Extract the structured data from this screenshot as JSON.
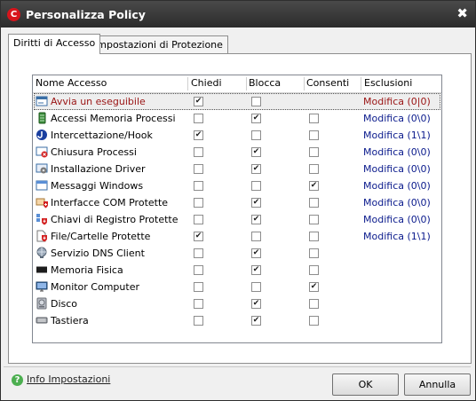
{
  "window": {
    "title": "Personalizza Policy",
    "close_glyph": "✖"
  },
  "tabs": [
    {
      "label": "Diritti di Accesso",
      "active": true
    },
    {
      "label": "Impostazioni di Protezione",
      "active": false
    }
  ],
  "table": {
    "columns": [
      "Nome Accesso",
      "Chiedi",
      "Blocca",
      "Consenti",
      "Esclusioni"
    ],
    "rows": [
      {
        "name": "Avvia un eseguibile",
        "icon": "window-run-icon",
        "chiedi": true,
        "blocca": false,
        "consenti": null,
        "esclusioni": "Modifica (0|0)",
        "selected": true
      },
      {
        "name": "Accessi Memoria Processi",
        "icon": "memory-process-icon",
        "chiedi": false,
        "blocca": true,
        "consenti": false,
        "esclusioni": "Modifica (0\\0)"
      },
      {
        "name": "Intercettazione/Hook",
        "icon": "hook-icon",
        "chiedi": true,
        "blocca": false,
        "consenti": false,
        "esclusioni": "Modifica (1\\1)"
      },
      {
        "name": "Chiusura Processi",
        "icon": "close-process-icon",
        "chiedi": false,
        "blocca": true,
        "consenti": false,
        "esclusioni": "Modifica (0\\0)"
      },
      {
        "name": "Installazione Driver",
        "icon": "driver-install-icon",
        "chiedi": false,
        "blocca": true,
        "consenti": false,
        "esclusioni": "Modifica (0\\0)"
      },
      {
        "name": "Messaggi Windows",
        "icon": "windows-messages-icon",
        "chiedi": false,
        "blocca": false,
        "consenti": true,
        "esclusioni": "Modifica (0\\0)"
      },
      {
        "name": "Interfacce COM Protette",
        "icon": "com-shield-icon",
        "chiedi": false,
        "blocca": true,
        "consenti": false,
        "esclusioni": "Modifica (0\\0)"
      },
      {
        "name": "Chiavi di Registro Protette",
        "icon": "registry-shield-icon",
        "chiedi": false,
        "blocca": true,
        "consenti": false,
        "esclusioni": "Modifica (0\\0)"
      },
      {
        "name": "File/Cartelle Protette",
        "icon": "file-shield-icon",
        "chiedi": true,
        "blocca": false,
        "consenti": false,
        "esclusioni": "Modifica (1\\1)"
      },
      {
        "name": "Servizio DNS Client",
        "icon": "dns-globe-icon",
        "chiedi": false,
        "blocca": true,
        "consenti": false,
        "esclusioni": ""
      },
      {
        "name": "Memoria Fisica",
        "icon": "ram-chip-icon",
        "chiedi": false,
        "blocca": true,
        "consenti": false,
        "esclusioni": ""
      },
      {
        "name": "Monitor Computer",
        "icon": "monitor-icon",
        "chiedi": false,
        "blocca": false,
        "consenti": true,
        "esclusioni": ""
      },
      {
        "name": "Disco",
        "icon": "disk-icon",
        "chiedi": false,
        "blocca": true,
        "consenti": false,
        "esclusioni": ""
      },
      {
        "name": "Tastiera",
        "icon": "keyboard-icon",
        "chiedi": false,
        "blocca": true,
        "consenti": false,
        "esclusioni": ""
      }
    ]
  },
  "footer": {
    "help_link": "Info Impostazioni",
    "ok_label": "OK",
    "cancel_label": "Annulla"
  },
  "colors": {
    "accent_red": "#d8141c",
    "link_blue": "#0a1a8c",
    "selected_text": "#9a1414"
  }
}
